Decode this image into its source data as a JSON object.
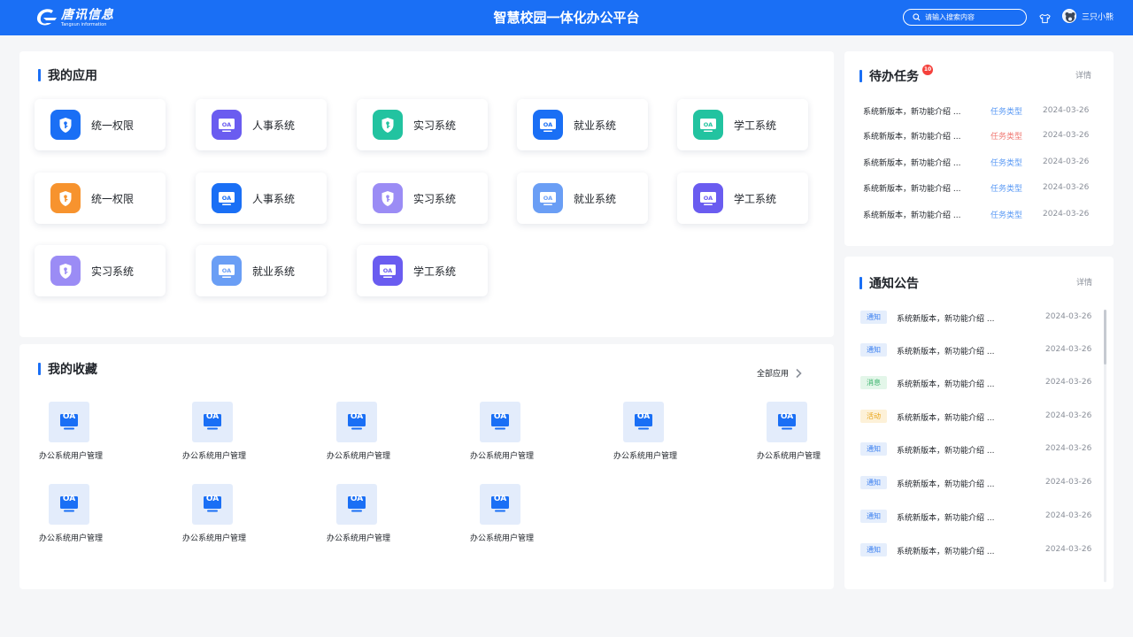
{
  "header": {
    "logo_text": "唐讯信息",
    "logo_sub": "Tangxun information",
    "title": "智慧校园一体化办公平台",
    "search_placeholder": "请输入搜索内容",
    "username": "三只小熊"
  },
  "colors": {
    "brand": "#1a6ff5",
    "background": "#f5f6f8",
    "tag_notice": "#3a7ff0",
    "tag_message": "#39b36b",
    "tag_activity": "#e8a417",
    "task_type_blue": "#5b9af5",
    "task_type_red": "#f07a74"
  },
  "apps": {
    "title": "我的应用",
    "items": [
      {
        "label": "统一权限",
        "icon": "shield-icon",
        "color": "#1a6ff5"
      },
      {
        "label": "人事系统",
        "icon": "oa-monitor-icon",
        "color": "#6a5cf0"
      },
      {
        "label": "实习系统",
        "icon": "shield-icon",
        "color": "#22c3a0"
      },
      {
        "label": "就业系统",
        "icon": "oa-monitor-icon",
        "color": "#1a6ff5"
      },
      {
        "label": "学工系统",
        "icon": "oa-monitor-icon",
        "color": "#22c3a0"
      },
      {
        "label": "统一权限",
        "icon": "shield-icon",
        "color": "#f7932e"
      },
      {
        "label": "人事系统",
        "icon": "oa-monitor-icon",
        "color": "#1a6ff5"
      },
      {
        "label": "实习系统",
        "icon": "shield-icon",
        "color": "#9b8cf5"
      },
      {
        "label": "就业系统",
        "icon": "oa-monitor-icon",
        "color": "#6a9ef5"
      },
      {
        "label": "学工系统",
        "icon": "oa-monitor-icon",
        "color": "#6a5cf0"
      },
      {
        "label": "实习系统",
        "icon": "shield-icon",
        "color": "#9b8cf5"
      },
      {
        "label": "就业系统",
        "icon": "oa-monitor-icon",
        "color": "#6a9ef5"
      },
      {
        "label": "学工系统",
        "icon": "oa-monitor-icon",
        "color": "#6a5cf0"
      }
    ]
  },
  "favorites": {
    "title": "我的收藏",
    "all_apps_label": "全部应用",
    "icon_text": "OA",
    "items": [
      "办公系统用户管理",
      "办公系统用户管理",
      "办公系统用户管理",
      "办公系统用户管理",
      "办公系统用户管理",
      "办公系统用户管理",
      "办公系统用户管理",
      "办公系统用户管理",
      "办公系统用户管理",
      "办公系统用户管理"
    ]
  },
  "tasks": {
    "title": "待办任务",
    "badge_count": "10",
    "detail_label": "详情",
    "items": [
      {
        "text": "系统新版本，新功能介绍 ...",
        "type": "任务类型",
        "type_color": "#5b9af5",
        "date": "2024-03-26"
      },
      {
        "text": "系统新版本，新功能介绍 ...",
        "type": "任务类型",
        "type_color": "#f07a74",
        "date": "2024-03-26"
      },
      {
        "text": "系统新版本，新功能介绍 ...",
        "type": "任务类型",
        "type_color": "#5b9af5",
        "date": "2024-03-26"
      },
      {
        "text": "系统新版本，新功能介绍 ...",
        "type": "任务类型",
        "type_color": "#5b9af5",
        "date": "2024-03-26"
      },
      {
        "text": "系统新版本，新功能介绍 ...",
        "type": "任务类型",
        "type_color": "#5b9af5",
        "date": "2024-03-26"
      }
    ]
  },
  "notices": {
    "title": "通知公告",
    "detail_label": "详情",
    "items": [
      {
        "tag": "通知",
        "tag_color": "#3a7ff0",
        "tag_bg": "#e5eefc",
        "text": "系统新版本，新功能介绍 ...",
        "date": "2024-03-26"
      },
      {
        "tag": "通知",
        "tag_color": "#3a7ff0",
        "tag_bg": "#e5eefc",
        "text": "系统新版本，新功能介绍 ...",
        "date": "2024-03-26"
      },
      {
        "tag": "消息",
        "tag_color": "#39b36b",
        "tag_bg": "#e3f6e9",
        "text": "系统新版本，新功能介绍 ...",
        "date": "2024-03-26"
      },
      {
        "tag": "活动",
        "tag_color": "#e8a417",
        "tag_bg": "#fdf1d8",
        "text": "系统新版本，新功能介绍 ...",
        "date": "2024-03-26"
      },
      {
        "tag": "通知",
        "tag_color": "#3a7ff0",
        "tag_bg": "#e5eefc",
        "text": "系统新版本，新功能介绍 ...",
        "date": "2024-03-26"
      },
      {
        "tag": "通知",
        "tag_color": "#3a7ff0",
        "tag_bg": "#e5eefc",
        "text": "系统新版本，新功能介绍 ...",
        "date": "2024-03-26"
      },
      {
        "tag": "通知",
        "tag_color": "#3a7ff0",
        "tag_bg": "#e5eefc",
        "text": "系统新版本，新功能介绍 ...",
        "date": "2024-03-26"
      },
      {
        "tag": "通知",
        "tag_color": "#3a7ff0",
        "tag_bg": "#e5eefc",
        "text": "系统新版本，新功能介绍 ...",
        "date": "2024-03-26"
      }
    ]
  }
}
